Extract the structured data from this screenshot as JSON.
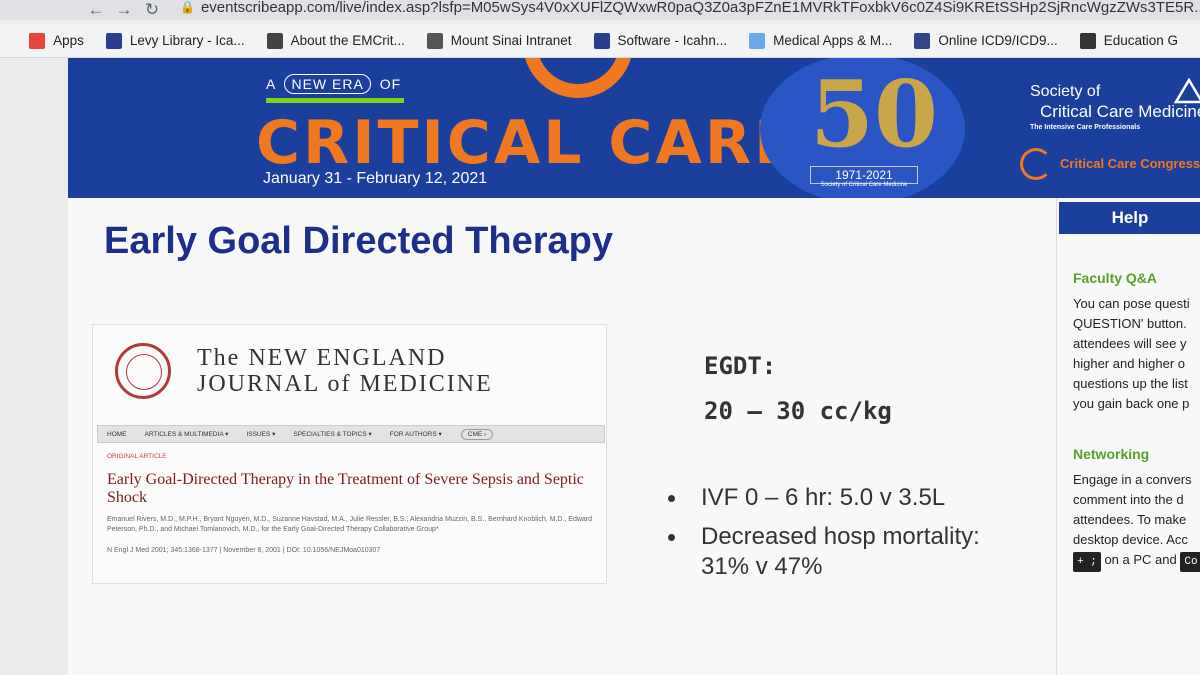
{
  "browser": {
    "url": "eventscribeapp.com/live/index.asp?lsfp=M05wSys4V0xXUFlZQWxwR0paQ3Z0a3pFZnE1MVRkTFoxbkV6c0Z4Si9KREtSSHp2SjRncWgzZWs3TE5R...",
    "bookmarks": [
      {
        "label": "Apps",
        "color": "#e8453c"
      },
      {
        "label": "Levy Library - Ica...",
        "color": "#2a3d8f"
      },
      {
        "label": "About the EMCrit...",
        "color": "#444444"
      },
      {
        "label": "Mount Sinai Intranet",
        "color": "#555555"
      },
      {
        "label": "Software - Icahn...",
        "color": "#2a3d8f"
      },
      {
        "label": "Medical Apps & M...",
        "color": "#6aa9e9"
      },
      {
        "label": "Online ICD9/ICD9...",
        "color": "#334488"
      },
      {
        "label": "Education G",
        "color": "#333333"
      }
    ]
  },
  "banner": {
    "tagline_pre": "A",
    "tagline_circled": "NEW ERA",
    "tagline_post": "OF",
    "title": "CRITICAL CARE",
    "dates": "January 31 - February 12, 2021",
    "anniversary_number": "50",
    "anniversary_years": "1971-2021",
    "anniversary_sub": "Society of Critical Care Medicine",
    "org_line1": "Society of",
    "org_line2": "Critical Care Medicine",
    "org_tagline": "The Intensive Care Professionals",
    "congress": "Critical Care Congress",
    "colors": {
      "navy": "#1b3f9c",
      "orange": "#f07820",
      "green": "#7ed321",
      "gold": "#caa54a"
    }
  },
  "slide": {
    "title": "Early Goal Directed Therapy",
    "journal": {
      "line1": "The NEW ENGLAND",
      "line2": "JOURNAL of MEDICINE",
      "nav": [
        "HOME",
        "ARTICLES & MULTIMEDIA ▾",
        "ISSUES ▾",
        "SPECIALTIES & TOPICS ▾",
        "FOR AUTHORS ▾",
        "CME ›"
      ],
      "section": "ORIGINAL ARTICLE",
      "article_title": "Early Goal-Directed Therapy in the Treatment of Severe Sepsis and Septic Shock",
      "authors": "Emanuel Rivers, M.D., M.P.H., Bryant Nguyen, M.D., Suzanne Havstad, M.A., Julie Ressler, B.S., Alexandria Muzzin, B.S., Bernhard Knoblich, M.D., Edward Peterson, Ph.D., and Michael Tomlanovich, M.D., for the Early Goal-Directed Therapy Collaborative Group*",
      "citation": "N Engl J Med 2001; 345:1368-1377 | November 8, 2001 | DOI: 10.1056/NEJMoa010307"
    },
    "egdt_label": "EGDT:",
    "egdt_dose": "20 – 30 cc/kg",
    "bullets": [
      "IVF 0 – 6 hr: 5.0 v 3.5L",
      "Decreased hosp mortality: 31% v 47%"
    ]
  },
  "help": {
    "title": "Help",
    "faculty_heading": "Faculty Q&A",
    "faculty_lines": [
      "You can pose questi",
      "QUESTION' button.",
      "attendees will see y",
      "higher and higher o",
      "questions up the list",
      "you gain back one p"
    ],
    "networking_heading": "Networking",
    "networking_lines": [
      "Engage in a convers",
      "comment into the d",
      "attendees. To make",
      "desktop device. Acc"
    ],
    "shortcut_key": "+ ;",
    "shortcut_text": "on a PC and",
    "shortcut_key2": "Co"
  }
}
